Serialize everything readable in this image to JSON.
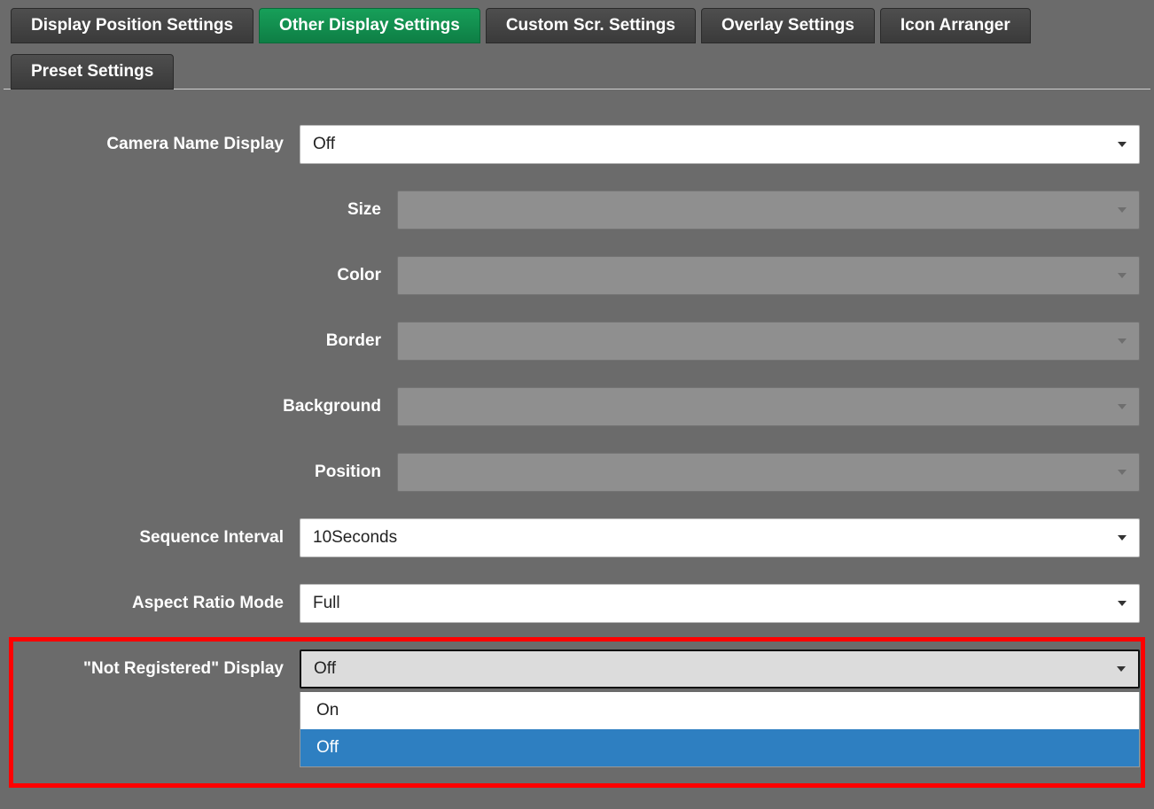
{
  "tabs": {
    "row1": [
      "Display Position Settings",
      "Other Display Settings",
      "Custom Scr. Settings",
      "Overlay Settings",
      "Icon Arranger"
    ],
    "row2": [
      "Preset Settings"
    ],
    "active": "Other Display Settings"
  },
  "fields": {
    "camera_name_display": {
      "label": "Camera Name Display",
      "value": "Off"
    },
    "size": {
      "label": "Size",
      "value": ""
    },
    "color": {
      "label": "Color",
      "value": ""
    },
    "border": {
      "label": "Border",
      "value": ""
    },
    "background": {
      "label": "Background",
      "value": ""
    },
    "position": {
      "label": "Position",
      "value": ""
    },
    "sequence_interval": {
      "label": "Sequence Interval",
      "value": "10Seconds"
    },
    "aspect_ratio_mode": {
      "label": "Aspect Ratio Mode",
      "value": "Full"
    },
    "not_registered": {
      "label": "\"Not Registered\" Display",
      "value": "Off",
      "options": [
        "On",
        "Off"
      ]
    }
  }
}
